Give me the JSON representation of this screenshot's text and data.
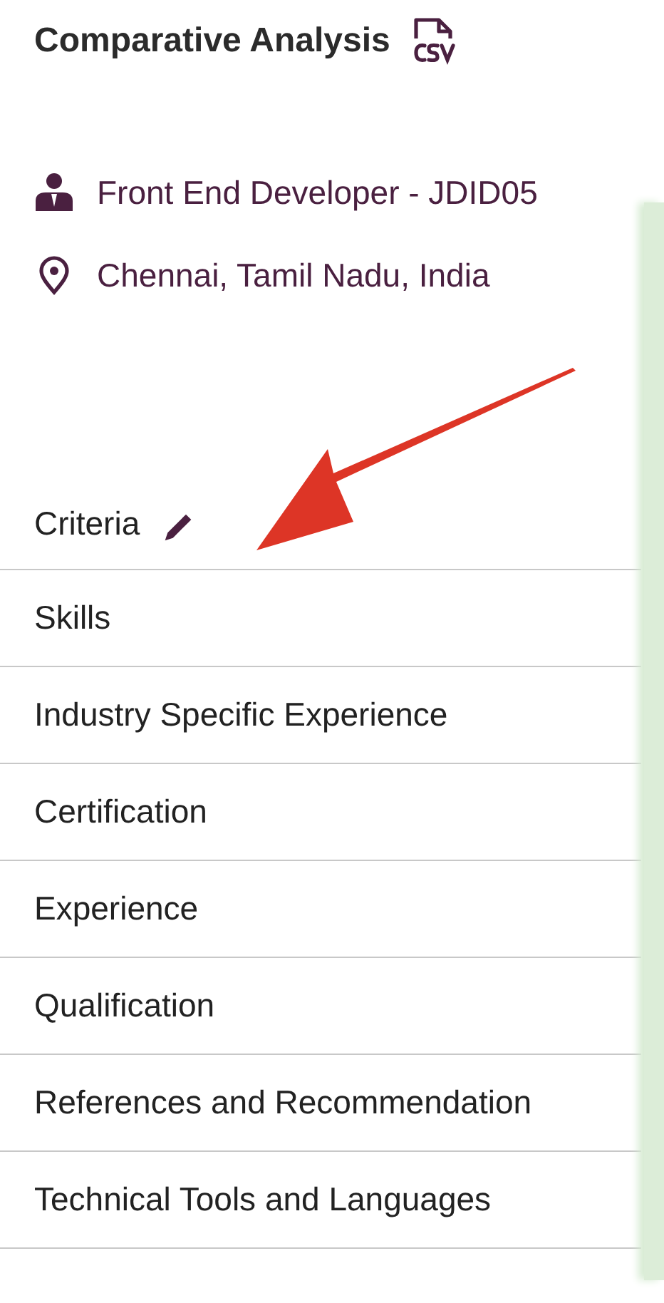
{
  "title": "Comparative Analysis",
  "job": {
    "role": "Front End Developer - JDID05",
    "location": "Chennai, Tamil Nadu, India"
  },
  "criteria": {
    "heading": "Criteria",
    "items": [
      "Skills",
      "Industry Specific Experience",
      "Certification",
      "Experience",
      "Qualification",
      "References and Recommendation",
      "Technical Tools and Languages"
    ]
  }
}
